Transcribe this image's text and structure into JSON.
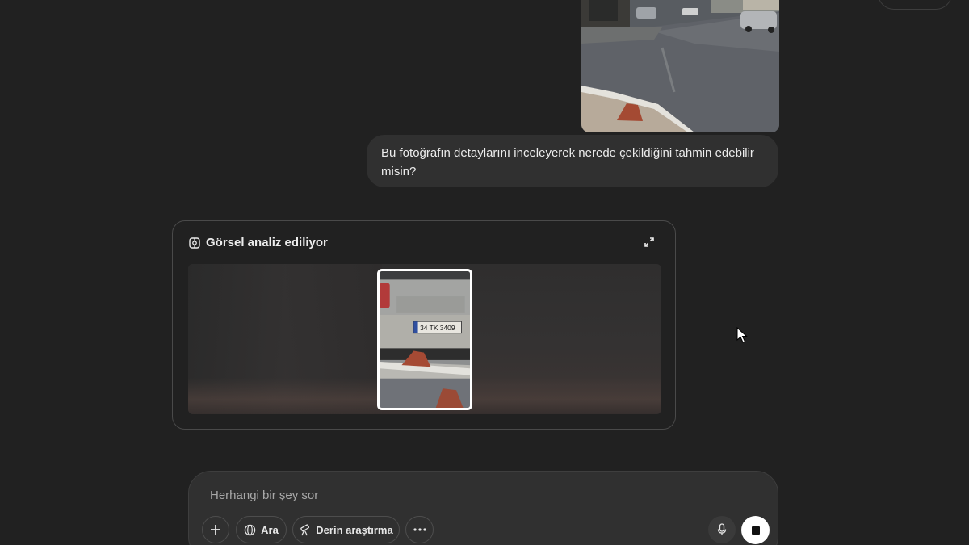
{
  "chat": {
    "user_message": "Bu fotoğrafın detaylarını inceleyerek nerede çekildiğini tahmin edebilir misin?"
  },
  "analysis": {
    "title": "Görsel analiz ediliyor",
    "plate_text": "34 TK 3409"
  },
  "composer": {
    "placeholder": "Herhangi bir şey sor",
    "search_label": "Ara",
    "deep_research_label": "Derin araştırma"
  },
  "icons": {
    "analysis": "image-analysis-icon",
    "expand": "expand-icon",
    "plus": "plus-icon",
    "globe": "globe-icon",
    "telescope": "telescope-icon",
    "more": "more-dots-icon",
    "mic": "microphone-icon",
    "stop": "stop-icon"
  },
  "colors": {
    "background": "#212121",
    "bubble": "#303030",
    "card_border": "#4a4a4a",
    "stop_button": "#ffffff"
  }
}
